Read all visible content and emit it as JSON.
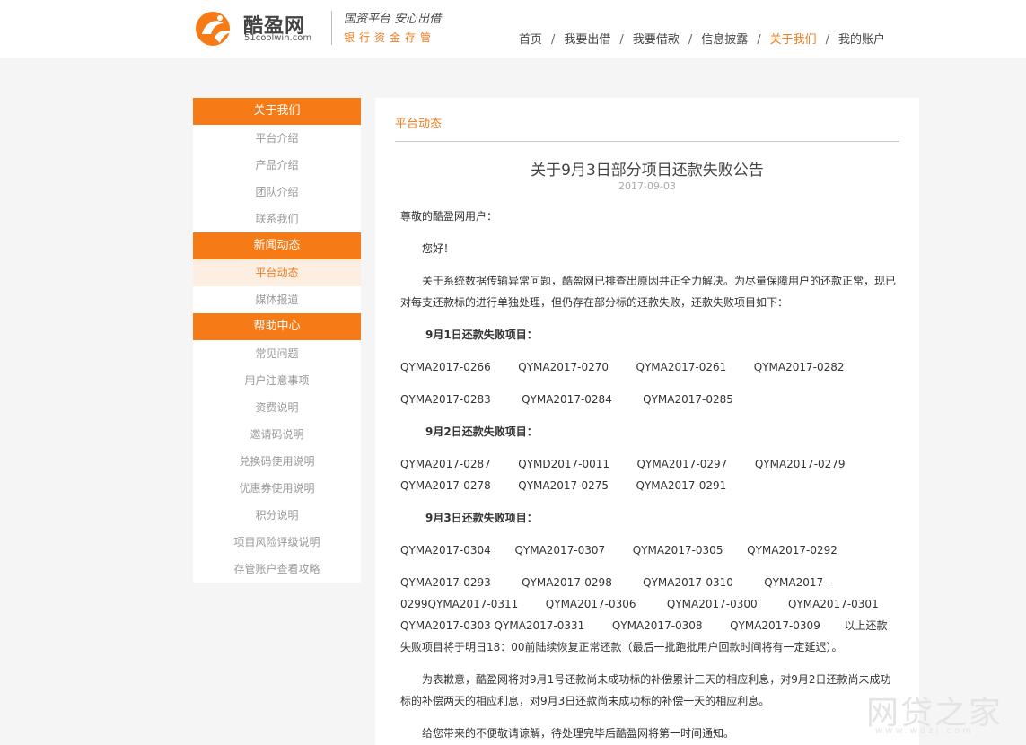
{
  "header": {
    "logo_cn": "酷盈网",
    "logo_en": "51coolwin.com",
    "slogan_top": "国资平台 安心出借",
    "slogan_bottom": "银行资金存管",
    "nav": [
      "首页",
      "我要出借",
      "我要借款",
      "信息披露",
      "关于我们",
      "我的账户"
    ],
    "nav_active": "关于我们",
    "nav_separator": "/"
  },
  "sidebar": {
    "groups": [
      {
        "title": "关于我们",
        "items": [
          "平台介绍",
          "产品介绍",
          "团队介绍",
          "联系我们"
        ]
      },
      {
        "title": "新闻动态",
        "items": [
          "平台动态",
          "媒体报道"
        ]
      },
      {
        "title": "帮助中心",
        "items": [
          "常见问题",
          "用户注意事项",
          "资费说明",
          "邀请码说明",
          "兑换码使用说明",
          "优惠券使用说明",
          "积分说明",
          "项目风险评级说明",
          "存管账户查看攻略"
        ]
      }
    ],
    "active_item": "平台动态"
  },
  "main": {
    "section_title": "平台动态",
    "article_title": "关于9月3日部分项目还款失败公告",
    "article_date": "2017-09-03",
    "greeting": "尊敬的酷盈网用户：",
    "hello": "您好！",
    "intro": "关于系统数据传输异常问题，酷盈网已排查出原因并正全力解决。为尽量保障用户的还款正常，现已对每支还款标的进行单独处理，但仍存在部分标的还款失败，还款失败项目如下：",
    "day1_heading": "9月1日还款失败项目：",
    "day1_line1": "QYMA2017-0266        QYMA2017-0270        QYMA2017-0261        QYMA2017-0282",
    "day1_line2": "QYMA2017-0283         QYMA2017-0284         QYMA2017-0285",
    "day2_heading": "9月2日还款失败项目：",
    "day2_text": "QYMA2017-0287        QYMD2017-0011        QYMA2017-0297        QYMA2017-0279    QYMA2017-0278        QYMA2017-0275        QYMA2017-0291",
    "day3_heading": "9月3日还款失败项目：",
    "day3_line1": "QYMA2017-0304       QYMA2017-0307        QYMA2017-0305       QYMA2017-0292",
    "day3_text": "QYMA2017-0293         QYMA2017-0298         QYMA2017-0310         QYMA2017-0299QYMA2017-0311        QYMA2017-0306         QYMA2017-0300         QYMA2017-0301   QYMA2017-0303 QYMA2017-0331        QYMA2017-0308        QYMA2017-0309       以上还款失败项目将于明日18：00前陆续恢复正常还款（最后一批跑批用户回款时间将有一定延迟）。",
    "compensation": "为表歉意，酷盈网将对9月1号还款尚未成功标的补偿累计三天的相应利息，对9月2日还款尚未成功标的补偿两天的相应利息，对9月3日还款尚未成功标的补偿一天的相应利息。",
    "closing": "给您带来的不便敬请谅解，待处理完毕后酷盈网将第一时间通知。"
  },
  "watermark": {
    "cn": "网贷之家",
    "en": "www.wdzj.com"
  },
  "colors": {
    "accent": "#f67b16",
    "active_bg": "#fdeee2"
  }
}
